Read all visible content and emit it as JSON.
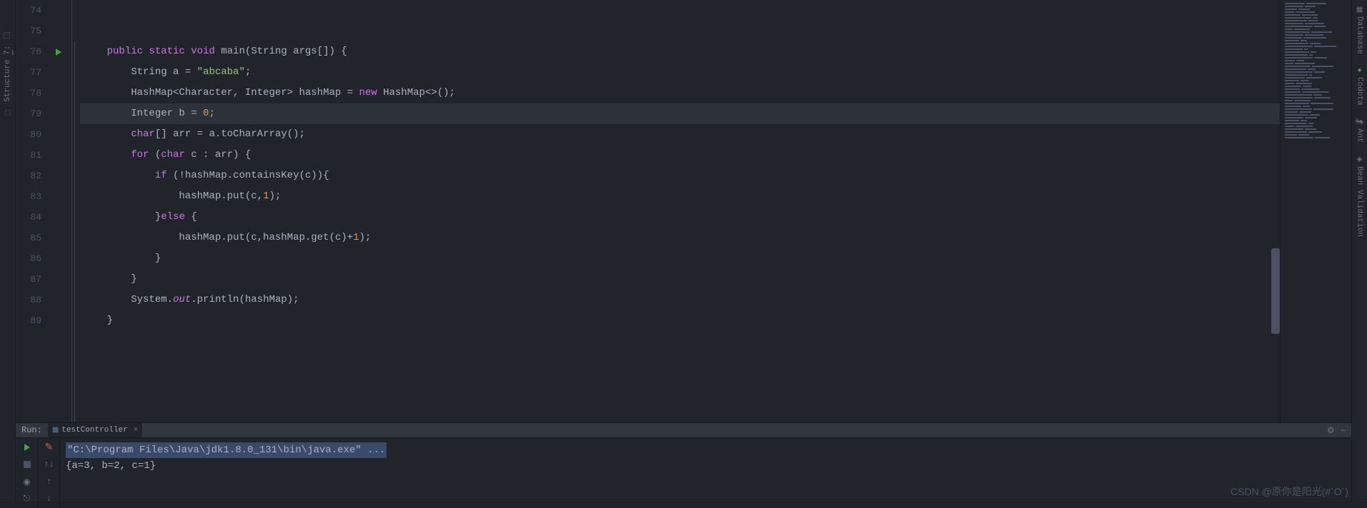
{
  "leftSidebar": {
    "structure": "Structure"
  },
  "rightSidebar": {
    "database": "Database",
    "codota": "Codota",
    "ant": "Ant",
    "beanValidation": "Bean Validation"
  },
  "editor": {
    "lineStart": 74,
    "lines": [
      {
        "n": 74,
        "t": ""
      },
      {
        "n": 75,
        "t": ""
      },
      {
        "n": 76,
        "t": "    ",
        "tokens": [
          {
            "c": "kw",
            "t": "public static void "
          },
          {
            "c": "method",
            "t": "main"
          },
          {
            "c": "ident",
            "t": "(String args[]) {"
          }
        ],
        "runIcon": true
      },
      {
        "n": 77,
        "t": "        ",
        "tokens": [
          {
            "c": "ident",
            "t": "String a = "
          },
          {
            "c": "str",
            "t": "\"abcaba\""
          },
          {
            "c": "ident",
            "t": ";"
          }
        ]
      },
      {
        "n": 78,
        "t": "        ",
        "tokens": [
          {
            "c": "ident",
            "t": "HashMap<Character, Integer> hashMap = "
          },
          {
            "c": "new",
            "t": "new "
          },
          {
            "c": "ident",
            "t": "HashMap<>();"
          }
        ]
      },
      {
        "n": 79,
        "t": "        ",
        "tokens": [
          {
            "c": "ident",
            "t": "Integer b = "
          },
          {
            "c": "num",
            "t": "0"
          },
          {
            "c": "ident",
            "t": ";"
          }
        ],
        "hl": true
      },
      {
        "n": 80,
        "t": "        ",
        "tokens": [
          {
            "c": "kw",
            "t": "char"
          },
          {
            "c": "ident",
            "t": "[] arr = a.toCharArray();"
          }
        ]
      },
      {
        "n": 81,
        "t": "        ",
        "tokens": [
          {
            "c": "kw",
            "t": "for "
          },
          {
            "c": "ident",
            "t": "("
          },
          {
            "c": "kw",
            "t": "char "
          },
          {
            "c": "ident",
            "t": "c : arr) {"
          }
        ]
      },
      {
        "n": 82,
        "t": "            ",
        "tokens": [
          {
            "c": "kw",
            "t": "if "
          },
          {
            "c": "ident",
            "t": "(!hashMap.containsKey(c)){"
          }
        ]
      },
      {
        "n": 83,
        "t": "                ",
        "tokens": [
          {
            "c": "ident",
            "t": "hashMap.put(c,"
          },
          {
            "c": "num",
            "t": "1"
          },
          {
            "c": "ident",
            "t": ");"
          }
        ]
      },
      {
        "n": 84,
        "t": "            ",
        "tokens": [
          {
            "c": "ident",
            "t": "}"
          },
          {
            "c": "kw",
            "t": "else "
          },
          {
            "c": "ident",
            "t": "{"
          }
        ]
      },
      {
        "n": 85,
        "t": "                ",
        "tokens": [
          {
            "c": "ident",
            "t": "hashMap.put(c,hashMap.get(c)+"
          },
          {
            "c": "num",
            "t": "1"
          },
          {
            "c": "ident",
            "t": ");"
          }
        ]
      },
      {
        "n": 86,
        "t": "            ",
        "tokens": [
          {
            "c": "ident",
            "t": "}"
          }
        ]
      },
      {
        "n": 87,
        "t": "        ",
        "tokens": [
          {
            "c": "ident",
            "t": "}"
          }
        ]
      },
      {
        "n": 88,
        "t": "        ",
        "tokens": [
          {
            "c": "ident",
            "t": "System."
          },
          {
            "c": "field-it",
            "t": "out"
          },
          {
            "c": "ident",
            "t": ".println(hashMap);"
          }
        ]
      },
      {
        "n": 89,
        "t": "    ",
        "tokens": [
          {
            "c": "ident",
            "t": "}"
          }
        ]
      }
    ]
  },
  "runPanel": {
    "label": "Run:",
    "tabName": "testController",
    "cmdLine": "\"C:\\Program Files\\Java\\jdk1.8.0_131\\bin\\java.exe\" ...",
    "outputLine": "{a=3, b=2, c=1}"
  },
  "watermark": "CSDN @原你是阳光(#`O´)"
}
